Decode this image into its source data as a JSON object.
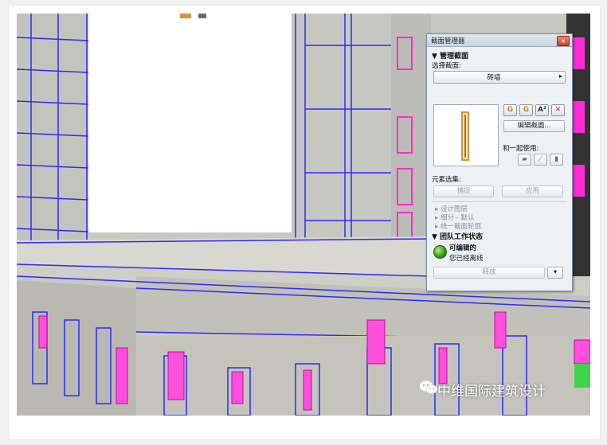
{
  "panel": {
    "title": "截面管理器",
    "close_label": "×",
    "manage_section_header": "▼ 管理截面",
    "select_section_label": "选择截面:",
    "section_dropdown_value": "砖墙",
    "dropdown_arrow": "▸",
    "tool_buttons": [
      "G",
      "G",
      "A²",
      "✕"
    ],
    "edit_section_button": "编辑截面...",
    "use_with_label": "和一起使用:",
    "element_set_label": "元素选集:",
    "capture_button": "捕捉",
    "apply_button": "应用",
    "tree_items": [
      "▸ 设计图层",
      "▸ 细分 - 默认",
      "▸ 统一截面轮廓"
    ],
    "team_status_header": "▼ 团队工作状态",
    "editable_status": "可编辑的",
    "offline_status": "您已经离线",
    "release_button": "释放",
    "release_arrow": "▾"
  },
  "watermark": {
    "text": "中维国际建筑设计"
  },
  "colors": {
    "accent_magenta": "#ff2bd6",
    "edge_blue": "#1b22ff",
    "status_green": "#2e9a14",
    "close_red": "#c7412a"
  }
}
